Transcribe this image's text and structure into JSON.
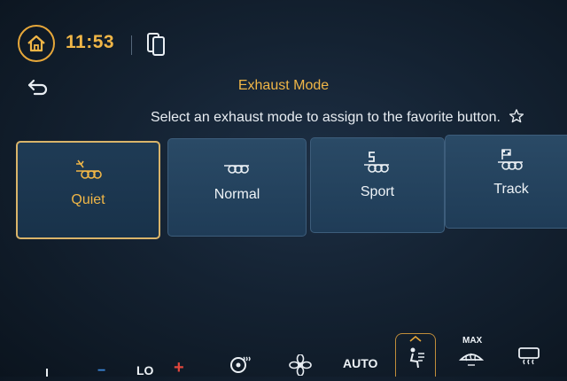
{
  "header": {
    "time": "11:53"
  },
  "page": {
    "title": "Exhaust Mode",
    "subtitle": "Select an exhaust mode to assign to the favorite button."
  },
  "modes": [
    {
      "label": "Quiet",
      "icon": "quiet-exhaust-icon",
      "selected": true
    },
    {
      "label": "Normal",
      "icon": "normal-exhaust-icon",
      "selected": false
    },
    {
      "label": "Sport",
      "icon": "sport-exhaust-icon",
      "selected": false
    },
    {
      "label": "Track",
      "icon": "track-exhaust-icon",
      "selected": false
    }
  ],
  "climate": {
    "temp_label": "LO",
    "plus": "+",
    "minus": "−",
    "auto_label": "AUTO",
    "max_label": "MAX"
  },
  "colors": {
    "accent": "#f0b647",
    "selected_border": "#d9b46a",
    "text": "#eef3f7",
    "warning": "#e0463c"
  }
}
